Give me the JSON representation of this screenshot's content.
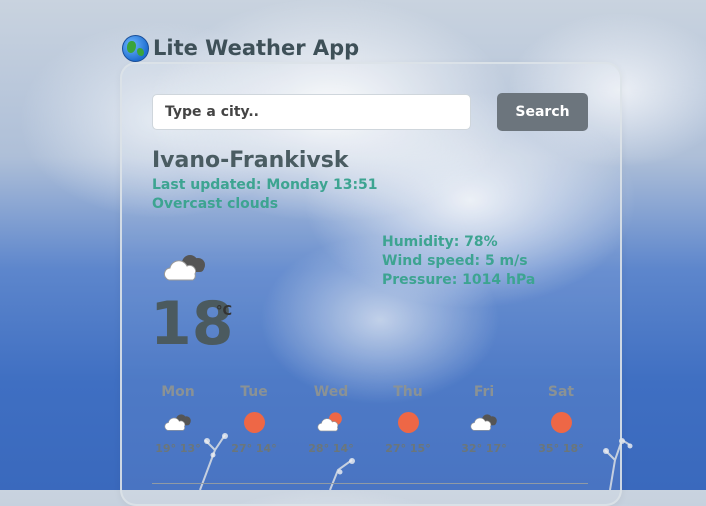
{
  "app": {
    "title": "Lite Weather App",
    "logo_icon": "globe-icon"
  },
  "search": {
    "placeholder": "Type a city..",
    "value": "",
    "button_label": "Search"
  },
  "current": {
    "city": "Ivano-Frankivsk",
    "last_updated": "Last updated: Monday 13:51",
    "description": "Overcast clouds",
    "icon": "clouds-icon",
    "temperature": "18",
    "unit": "°C",
    "humidity": "Humidity: 78%",
    "wind": "Wind speed: 5 m/s",
    "pressure": "Pressure: 1014 hPa"
  },
  "forecast": [
    {
      "day": "Mon",
      "icon": "clouds-icon",
      "temps": "19° 13°"
    },
    {
      "day": "Tue",
      "icon": "sun-icon",
      "temps": "27° 14°"
    },
    {
      "day": "Wed",
      "icon": "partly-cloudy-icon",
      "temps": "28° 14°"
    },
    {
      "day": "Thu",
      "icon": "sun-icon",
      "temps": "27° 15°"
    },
    {
      "day": "Fri",
      "icon": "clouds-icon",
      "temps": "32° 17°"
    },
    {
      "day": "Sat",
      "icon": "sun-icon",
      "temps": "35° 18°"
    }
  ],
  "colors": {
    "accent": "#3da491",
    "button": "#6c757d",
    "sun": "#ee6746",
    "heading": "#4a5c62"
  }
}
